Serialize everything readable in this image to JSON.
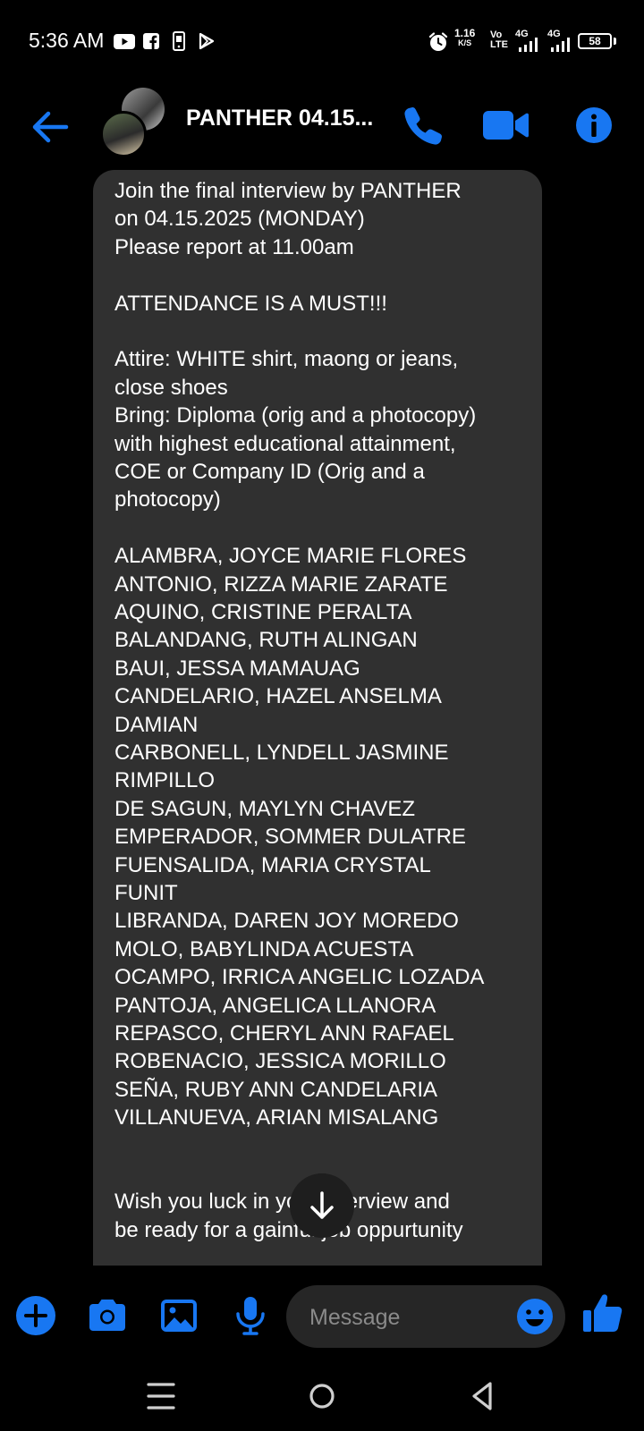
{
  "status_bar": {
    "time": "5:36 AM",
    "net_speed_value": "1.16",
    "net_speed_unit": "K/S",
    "volte_top": "Vo",
    "volte_bottom": "LTE",
    "sim1_type": "4G",
    "sim2_type": "4G",
    "battery": "58",
    "notification_icons": [
      "youtube-icon",
      "facebook-icon",
      "phone-device-icon",
      "play-store-icon"
    ],
    "system_icons": [
      "alarm-icon",
      "signal-icon",
      "battery-icon"
    ]
  },
  "header": {
    "title": "PANTHER 04.15...",
    "accent_color": "#1877f2",
    "icons": [
      "back-arrow-icon",
      "phone-call-icon",
      "video-call-icon",
      "info-icon"
    ]
  },
  "message": {
    "lines": [
      "Join the final interview by PANTHER",
      "on 04.15.2025 (MONDAY)",
      "Please report at 11.00am",
      "",
      "ATTENDANCE IS A MUST!!!",
      "",
      "Attire: WHITE shirt, maong or jeans,",
      "close shoes",
      "Bring: Diploma (orig and a photocopy)",
      "with highest educational attainment,",
      "COE or Company ID (Orig and a",
      "photocopy)",
      "",
      "ALAMBRA, JOYCE MARIE FLORES",
      "ANTONIO, RIZZA MARIE ZARATE",
      "AQUINO, CRISTINE PERALTA",
      "BALANDANG, RUTH ALINGAN",
      "BAUI, JESSA MAMAUAG",
      "CANDELARIO, HAZEL ANSELMA",
      "DAMIAN",
      "CARBONELL, LYNDELL JASMINE",
      "RIMPILLO",
      "DE SAGUN, MAYLYN CHAVEZ",
      "EMPERADOR, SOMMER DULATRE",
      "FUENSALIDA, MARIA CRYSTAL",
      "FUNIT",
      "LIBRANDA, DAREN JOY MOREDO",
      "MOLO, BABYLINDA ACUESTA",
      "OCAMPO, IRRICA ANGELIC LOZADA",
      "PANTOJA, ANGELICA LLANORA",
      "REPASCO, CHERYL ANN RAFAEL",
      "ROBENACIO, JESSICA MORILLO",
      "SEÑA, RUBY ANN CANDELARIA",
      "VILLANUEVA, ARIAN MISALANG",
      "",
      "",
      "Wish you luck in your interview and",
      "be ready for a gainful job oppurtunity"
    ],
    "bubble_color": "#303030"
  },
  "composer": {
    "placeholder": "Message",
    "icons": [
      "plus-icon",
      "camera-icon",
      "gallery-icon",
      "microphone-icon",
      "emoji-icon",
      "thumbs-up-icon"
    ]
  },
  "nav_bar": {
    "icons": [
      "menu-icon",
      "home-icon",
      "back-icon"
    ]
  }
}
